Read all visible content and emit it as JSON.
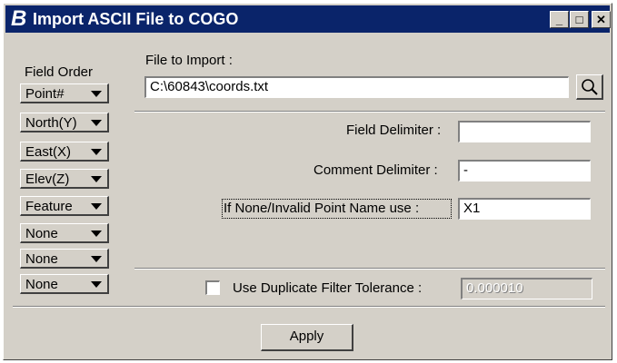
{
  "window": {
    "title": "Import ASCII File to COGO",
    "icon": "B",
    "controls": {
      "minimize": "_",
      "maximize": "□",
      "close": "✕"
    }
  },
  "field_order": {
    "label": "Field Order",
    "items": [
      "Point#",
      "North(Y)",
      "East(X)",
      "Elev(Z)",
      "Feature",
      "None",
      "None",
      "None"
    ]
  },
  "file_import": {
    "label": "File to Import :",
    "value": "C:\\60843\\coords.txt"
  },
  "field_delimiter": {
    "label": "Field Delimiter :",
    "value": ""
  },
  "comment_delimiter": {
    "label": "Comment Delimiter :",
    "value": "-"
  },
  "invalid_point": {
    "label": "If None/Invalid Point Name use :",
    "value": "X1"
  },
  "duplicate_filter": {
    "label": "Use Duplicate Filter Tolerance :",
    "checked": false,
    "value": "0.000010"
  },
  "apply_label": "Apply"
}
